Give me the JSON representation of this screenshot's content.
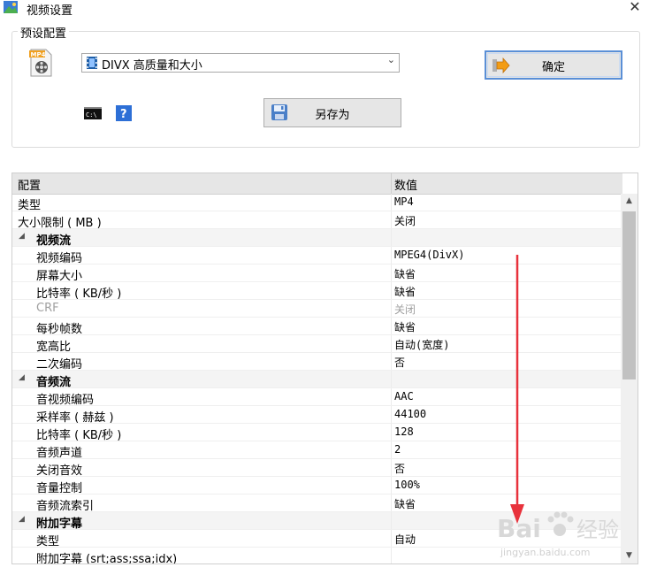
{
  "window": {
    "title": "视频设置"
  },
  "preset": {
    "group_label": "预设配置",
    "selected": "DIVX 高质量和大小",
    "ok_label": "确定",
    "save_as_label": "另存为"
  },
  "grid": {
    "header": {
      "col1": "配置",
      "col2": "数值"
    },
    "rows": [
      {
        "kind": "item",
        "indent": false,
        "label": "类型",
        "value": "MP4"
      },
      {
        "kind": "item",
        "indent": false,
        "label": "大小限制 ( MB )",
        "value": "关闭"
      },
      {
        "kind": "category",
        "label": "视频流",
        "value": ""
      },
      {
        "kind": "item",
        "indent": true,
        "label": "视频编码",
        "value": "MPEG4(DivX)"
      },
      {
        "kind": "item",
        "indent": true,
        "label": "屏幕大小",
        "value": "缺省"
      },
      {
        "kind": "item",
        "indent": true,
        "label": "比特率 ( KB/秒 )",
        "value": "缺省"
      },
      {
        "kind": "disabled",
        "indent": true,
        "label": "CRF",
        "value": "关闭"
      },
      {
        "kind": "item",
        "indent": true,
        "label": "每秒帧数",
        "value": "缺省"
      },
      {
        "kind": "item",
        "indent": true,
        "label": "宽高比",
        "value": "自动(宽度)"
      },
      {
        "kind": "item",
        "indent": true,
        "label": "二次编码",
        "value": "否"
      },
      {
        "kind": "category",
        "label": "音频流",
        "value": ""
      },
      {
        "kind": "item",
        "indent": true,
        "label": "音视频编码",
        "value": "AAC"
      },
      {
        "kind": "item",
        "indent": true,
        "label": "采样率 ( 赫兹 )",
        "value": "44100"
      },
      {
        "kind": "item",
        "indent": true,
        "label": "比特率 ( KB/秒 )",
        "value": "128"
      },
      {
        "kind": "item",
        "indent": true,
        "label": "音频声道",
        "value": "2"
      },
      {
        "kind": "item",
        "indent": true,
        "label": "关闭音效",
        "value": "否"
      },
      {
        "kind": "item",
        "indent": true,
        "label": "音量控制",
        "value": "100%"
      },
      {
        "kind": "item",
        "indent": true,
        "label": "音频流索引",
        "value": "缺省"
      },
      {
        "kind": "category",
        "label": "附加字幕",
        "value": ""
      },
      {
        "kind": "item",
        "indent": true,
        "label": "类型",
        "value": "自动"
      },
      {
        "kind": "item",
        "indent": true,
        "label": "附加字幕 (srt;ass;ssa;idx)",
        "value": ""
      }
    ]
  },
  "icons": {
    "app": "app-icon",
    "file": "mp4-file-icon",
    "combo": "film-icon",
    "ok": "orange-arrow-icon",
    "save": "floppy-disk-icon",
    "cmd": "command-prompt-icon",
    "help": "help-icon"
  },
  "watermark": {
    "brand": "Bai",
    "brand_tail": "经验",
    "url": "jingyan.baidu.com"
  },
  "colors": {
    "annotation_arrow": "#e8323c",
    "ok_border": "#5a8fd6",
    "category_bg": "#f4f4f4"
  }
}
